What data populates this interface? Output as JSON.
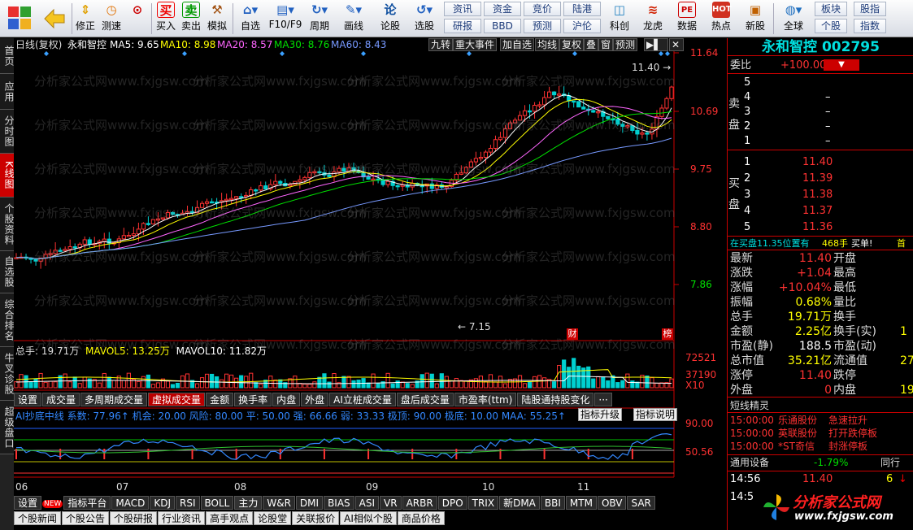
{
  "toolbar": {
    "items": [
      {
        "label": "修正",
        "icon": "arrow-up-down-icon"
      },
      {
        "label": "测速",
        "icon": "clock-icon"
      },
      {
        "label": "买入",
        "icon": "buy-icon",
        "glyph": "买"
      },
      {
        "label": "卖出",
        "icon": "sell-icon",
        "glyph": "卖"
      },
      {
        "label": "模拟",
        "icon": "hammer-icon"
      },
      {
        "label": "自选",
        "icon": "house-icon"
      },
      {
        "label": "F10/F9",
        "icon": "f10-icon"
      },
      {
        "label": "周期",
        "icon": "cycle-icon"
      },
      {
        "label": "画线",
        "icon": "pen-icon"
      },
      {
        "label": "论股",
        "icon": "discuss-icon",
        "glyph": "论"
      },
      {
        "label": "选股",
        "icon": "select-stock-icon"
      },
      {
        "label": "科创",
        "icon": "sci-tech-icon"
      },
      {
        "label": "龙虎",
        "icon": "dragon-tiger-icon"
      },
      {
        "label": "数据",
        "icon": "data-pe-icon",
        "glyph": "PE"
      },
      {
        "label": "热点",
        "icon": "hot-icon"
      },
      {
        "label": "新股",
        "icon": "new-stock-icon"
      },
      {
        "label": "全球",
        "icon": "globe-icon"
      }
    ],
    "small": [
      "资讯",
      "资金",
      "竞价",
      "陆港",
      "研报",
      "BBD",
      "预测",
      "沪伦",
      "板块",
      "股指",
      "个股",
      "指数"
    ]
  },
  "left_tabs": [
    "首页",
    "应用",
    "分时图",
    "K线图",
    "个股资料",
    "自选股",
    "综合排名",
    "牛叉诊股",
    "超级盘口"
  ],
  "chart": {
    "header": {
      "period": "日线(复权)",
      "name": "永和智控",
      "ma5": "MA5: 9.65",
      "ma10": "MA10: 8.98",
      "ma20": "MA20: 8.57",
      "ma30": "MA30: 8.76",
      "ma60": "MA60: 8.43"
    },
    "top_tabs": [
      "九转",
      "重大事件",
      "加自选",
      "均线",
      "复权",
      "叠",
      "窗",
      "预测"
    ],
    "price_ticks": [
      "11.64",
      "10.69",
      "9.75",
      "8.80",
      "7.86"
    ],
    "high_label": "11.40",
    "low_label": "7.15",
    "marks": [
      "财",
      "榜"
    ],
    "vol_header": {
      "total": "总手: 19.71万",
      "mavol5": "MAVOL5: 13.25万",
      "mavol10": "MAVOL10: 11.82万"
    },
    "vol_ticks": [
      "72521",
      "37190",
      "X10"
    ],
    "indicator_tabs": [
      "设置",
      "成交量",
      "多周期成交量",
      "虚拟成交量",
      "金额",
      "换手率",
      "内盘",
      "外盘",
      "AI立桩成交量",
      "盘后成交量",
      "市盈率(ttm)",
      "陆股通持股变化",
      "···"
    ],
    "indicator_header": "AI抄底中线 系数: 77.96↑ 机会: 20.00 风险: 80.00 平: 50.00 强: 66.66 弱: 33.33 极顶: 90.00 极底: 10.00 MAA: 55.25↑",
    "indicator_buttons": [
      "指标升级",
      "指标说明"
    ],
    "ind_ticks": [
      "90.00",
      "50.56"
    ],
    "months": [
      "06",
      "07",
      "08",
      "09",
      "10",
      "11"
    ],
    "bottom_tabs": [
      "设置",
      "指标平台",
      "MACD",
      "KDJ",
      "RSI",
      "BOLL",
      "主力",
      "W&R",
      "DMI",
      "BIAS",
      "ASI",
      "VR",
      "ARBR",
      "DPO",
      "TRIX",
      "新DMA",
      "BBI",
      "MTM",
      "OBV",
      "SAR"
    ],
    "new_badge": "NEW",
    "bottom_tabs2": [
      "个股新闻",
      "个股公告",
      "个股研报",
      "行业资讯",
      "高手观点",
      "论股堂",
      "关联报价",
      "AI相似个股",
      "商品价格"
    ],
    "watermark": "分析家公式网www.fxjgsw.com"
  },
  "quote": {
    "title": "永和智控 002795",
    "wb_label": "委比",
    "wb": "+100.00%",
    "sell_label": "卖盘",
    "buy_label": "买盘",
    "sells": [
      {
        "n": "5",
        "p": "",
        "v": ""
      },
      {
        "n": "4",
        "p": "–",
        "v": ""
      },
      {
        "n": "3",
        "p": "–",
        "v": ""
      },
      {
        "n": "2",
        "p": "–",
        "v": ""
      },
      {
        "n": "1",
        "p": "–",
        "v": ""
      }
    ],
    "buys": [
      {
        "n": "1",
        "p": "11.40",
        "v": ""
      },
      {
        "n": "2",
        "p": "11.39",
        "v": ""
      },
      {
        "n": "3",
        "p": "11.38",
        "v": ""
      },
      {
        "n": "4",
        "p": "11.37",
        "v": ""
      },
      {
        "n": "5",
        "p": "11.36",
        "v": ""
      }
    ],
    "banner": "在买盘11.35位置有",
    "banner_vol": "468手",
    "banner_tail": "买单!",
    "banner_more": "首",
    "stats": [
      {
        "l1": "最新",
        "v1": "11.40",
        "l2": "开盘",
        "v2": "",
        "c1": "red"
      },
      {
        "l1": "涨跌",
        "v1": "+1.04",
        "l2": "最高",
        "v2": "",
        "c1": "red"
      },
      {
        "l1": "涨幅",
        "v1": "+10.04%",
        "l2": "最低",
        "v2": "",
        "c1": "red"
      },
      {
        "l1": "振幅",
        "v1": "0.68%",
        "l2": "量比",
        "v2": "",
        "c1": "yel"
      },
      {
        "l1": "总手",
        "v1": "19.71万",
        "l2": "换手",
        "v2": "",
        "c1": "yel"
      },
      {
        "l1": "金额",
        "v1": "2.25亿",
        "l2": "换手(实)",
        "v2": "1",
        "c1": "yel"
      },
      {
        "l1": "市盈(静)",
        "v1": "188.5",
        "l2": "市盈(动)",
        "v2": "",
        "c1": "wht"
      },
      {
        "l1": "总市值",
        "v1": "35.21亿",
        "l2": "流通值",
        "v2": "27",
        "c1": "yel"
      },
      {
        "l1": "涨停",
        "v1": "11.40",
        "l2": "跌停",
        "v2": "",
        "c1": "red"
      },
      {
        "l1": "外盘",
        "v1": "0",
        "l2": "内盘",
        "v2": "19",
        "c1": "red"
      }
    ],
    "news_title": "短线精灵",
    "news": [
      {
        "t": "15:00:00",
        "s": "乐通股份",
        "e": "急速拉升"
      },
      {
        "t": "15:00:00",
        "s": "英联股份",
        "e": "打开跌停板"
      },
      {
        "t": "15:00:00",
        "s": "*ST奇信",
        "e": "封涨停板"
      }
    ],
    "sector": "通用设备",
    "sector_chg": "-1.79%",
    "sector_label": "同行",
    "tick": {
      "time": "14:56",
      "price": "11.40",
      "vol": "6"
    },
    "tick2_time": "14:5",
    "logo": "分析家公式网",
    "logo_url": "www.fxjgsw.com"
  }
}
